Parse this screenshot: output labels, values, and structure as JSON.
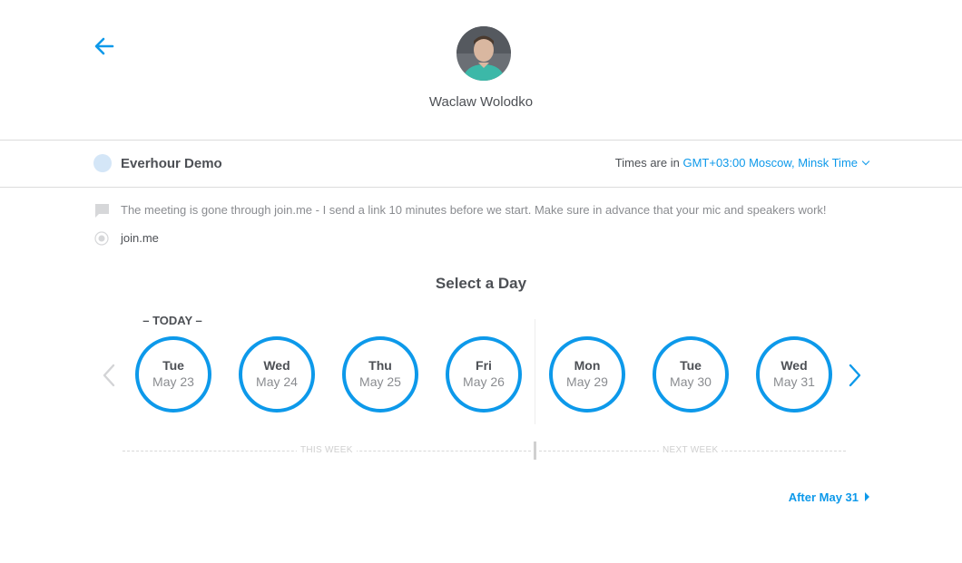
{
  "header": {
    "host_name": "Waclaw Wolodko"
  },
  "event": {
    "name": "Everhour Demo",
    "timezone_prefix": "Times are in",
    "timezone_value": "GMT+03:00 Moscow, Minsk Time",
    "description": "The meeting is gone through join.me - I send a link 10 minutes before we start. Make sure in advance that your mic and speakers work!",
    "location": "join.me"
  },
  "calendar": {
    "title": "Select a Day",
    "today_label": "– TODAY –",
    "days": [
      {
        "dow": "Tue",
        "date": "May 23"
      },
      {
        "dow": "Wed",
        "date": "May 24"
      },
      {
        "dow": "Thu",
        "date": "May 25"
      },
      {
        "dow": "Fri",
        "date": "May 26"
      },
      {
        "dow": "Mon",
        "date": "May 29"
      },
      {
        "dow": "Tue",
        "date": "May 30"
      },
      {
        "dow": "Wed",
        "date": "May 31"
      }
    ],
    "this_week_label": "THIS WEEK",
    "next_week_label": "NEXT WEEK",
    "after_label": "After May 31"
  },
  "colors": {
    "accent": "#0d99ea",
    "text": "#4d5055",
    "muted": "#8a8c90",
    "event_dot": "#d4e6f7"
  },
  "icons": [
    "back-arrow-icon",
    "comment-icon",
    "location-radio-icon",
    "chevron-left-icon",
    "chevron-right-icon",
    "chevron-down-icon",
    "triangle-right-icon"
  ]
}
